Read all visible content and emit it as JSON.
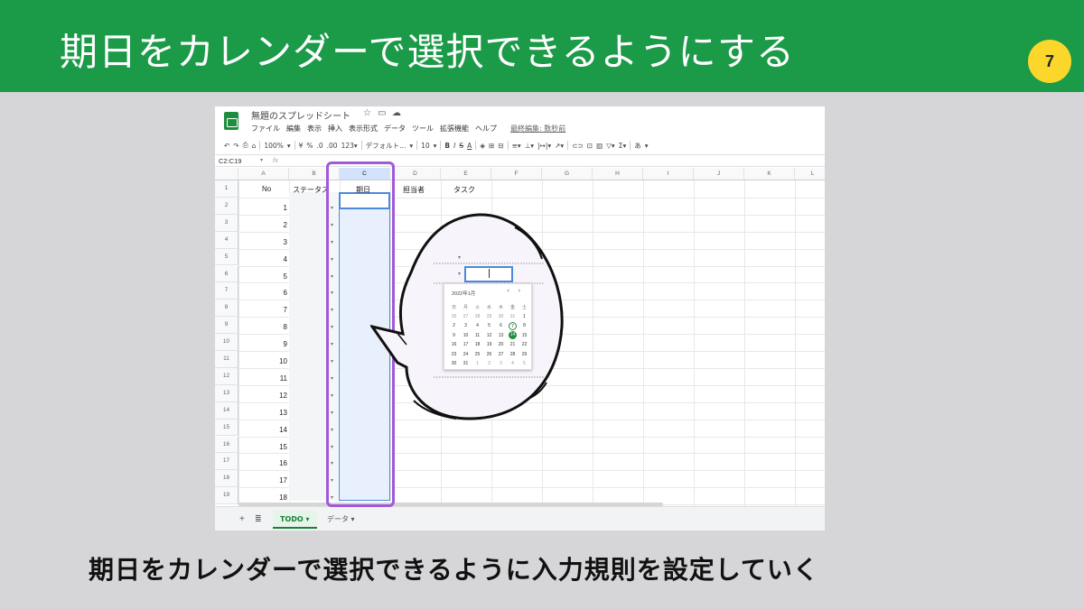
{
  "slide": {
    "title": "期日をカレンダーで選択できるようにする",
    "page_number": "7",
    "caption": "期日をカレンダーで選択できるように入力規則を設定していく",
    "header_color": "#1b9a48",
    "badge_color": "#fbd72b",
    "highlight_color": "#a259d9"
  },
  "sheets": {
    "doc_title": "無題のスプレッドシート",
    "title_icons": [
      "star-icon",
      "folder-icon",
      "cloud-icon"
    ],
    "menu": [
      "ファイル",
      "編集",
      "表示",
      "挿入",
      "表示形式",
      "データ",
      "ツール",
      "拡張機能",
      "ヘルプ"
    ],
    "last_edit": "最終編集: 数秒前",
    "toolbar": {
      "zoom": "100%",
      "currency": "¥",
      "percent": "%",
      "dec_decrease": ".0",
      "dec_increase": ".00",
      "format_123": "123▾",
      "font": "デフォルト...",
      "font_size": "10",
      "bold": "B",
      "italic": "I",
      "strike": "S",
      "text_color": "A",
      "input_tools": "あ"
    },
    "name_box": "C2:C19",
    "fx": "fx",
    "columns": [
      "A",
      "B",
      "C",
      "D",
      "E",
      "F",
      "G",
      "H",
      "I",
      "J",
      "K",
      "L"
    ],
    "rows": [
      "1",
      "2",
      "3",
      "4",
      "5",
      "6",
      "7",
      "8",
      "9",
      "10",
      "11",
      "12",
      "13",
      "14",
      "15",
      "16",
      "17",
      "18",
      "19"
    ],
    "headers": {
      "no": "No",
      "status": "ステータス",
      "due": "期日",
      "owner": "担当者",
      "task": "タスク"
    },
    "numbers": [
      "1",
      "2",
      "3",
      "4",
      "5",
      "6",
      "7",
      "8",
      "9",
      "10",
      "11",
      "12",
      "13",
      "14",
      "15",
      "16",
      "17",
      "18"
    ],
    "tabs": [
      {
        "label": "TODO ▾",
        "active": true
      },
      {
        "label": "データ ▾",
        "active": false
      }
    ],
    "add_sheet": "+",
    "all_sheets": "≣"
  },
  "calendar": {
    "month": "2022年1月",
    "nav": "‹ ›",
    "weekdays": [
      "日",
      "月",
      "火",
      "水",
      "木",
      "金",
      "土"
    ],
    "days": [
      [
        "26",
        "27",
        "28",
        "29",
        "30",
        "31",
        "1"
      ],
      [
        "2",
        "3",
        "4",
        "5",
        "6",
        "7",
        "8"
      ],
      [
        "9",
        "10",
        "11",
        "12",
        "13",
        "14",
        "15"
      ],
      [
        "16",
        "17",
        "18",
        "19",
        "20",
        "21",
        "22"
      ],
      [
        "23",
        "24",
        "25",
        "26",
        "27",
        "28",
        "29"
      ],
      [
        "30",
        "31",
        "1",
        "2",
        "3",
        "4",
        "5"
      ]
    ],
    "today": "7",
    "selected": "14"
  }
}
